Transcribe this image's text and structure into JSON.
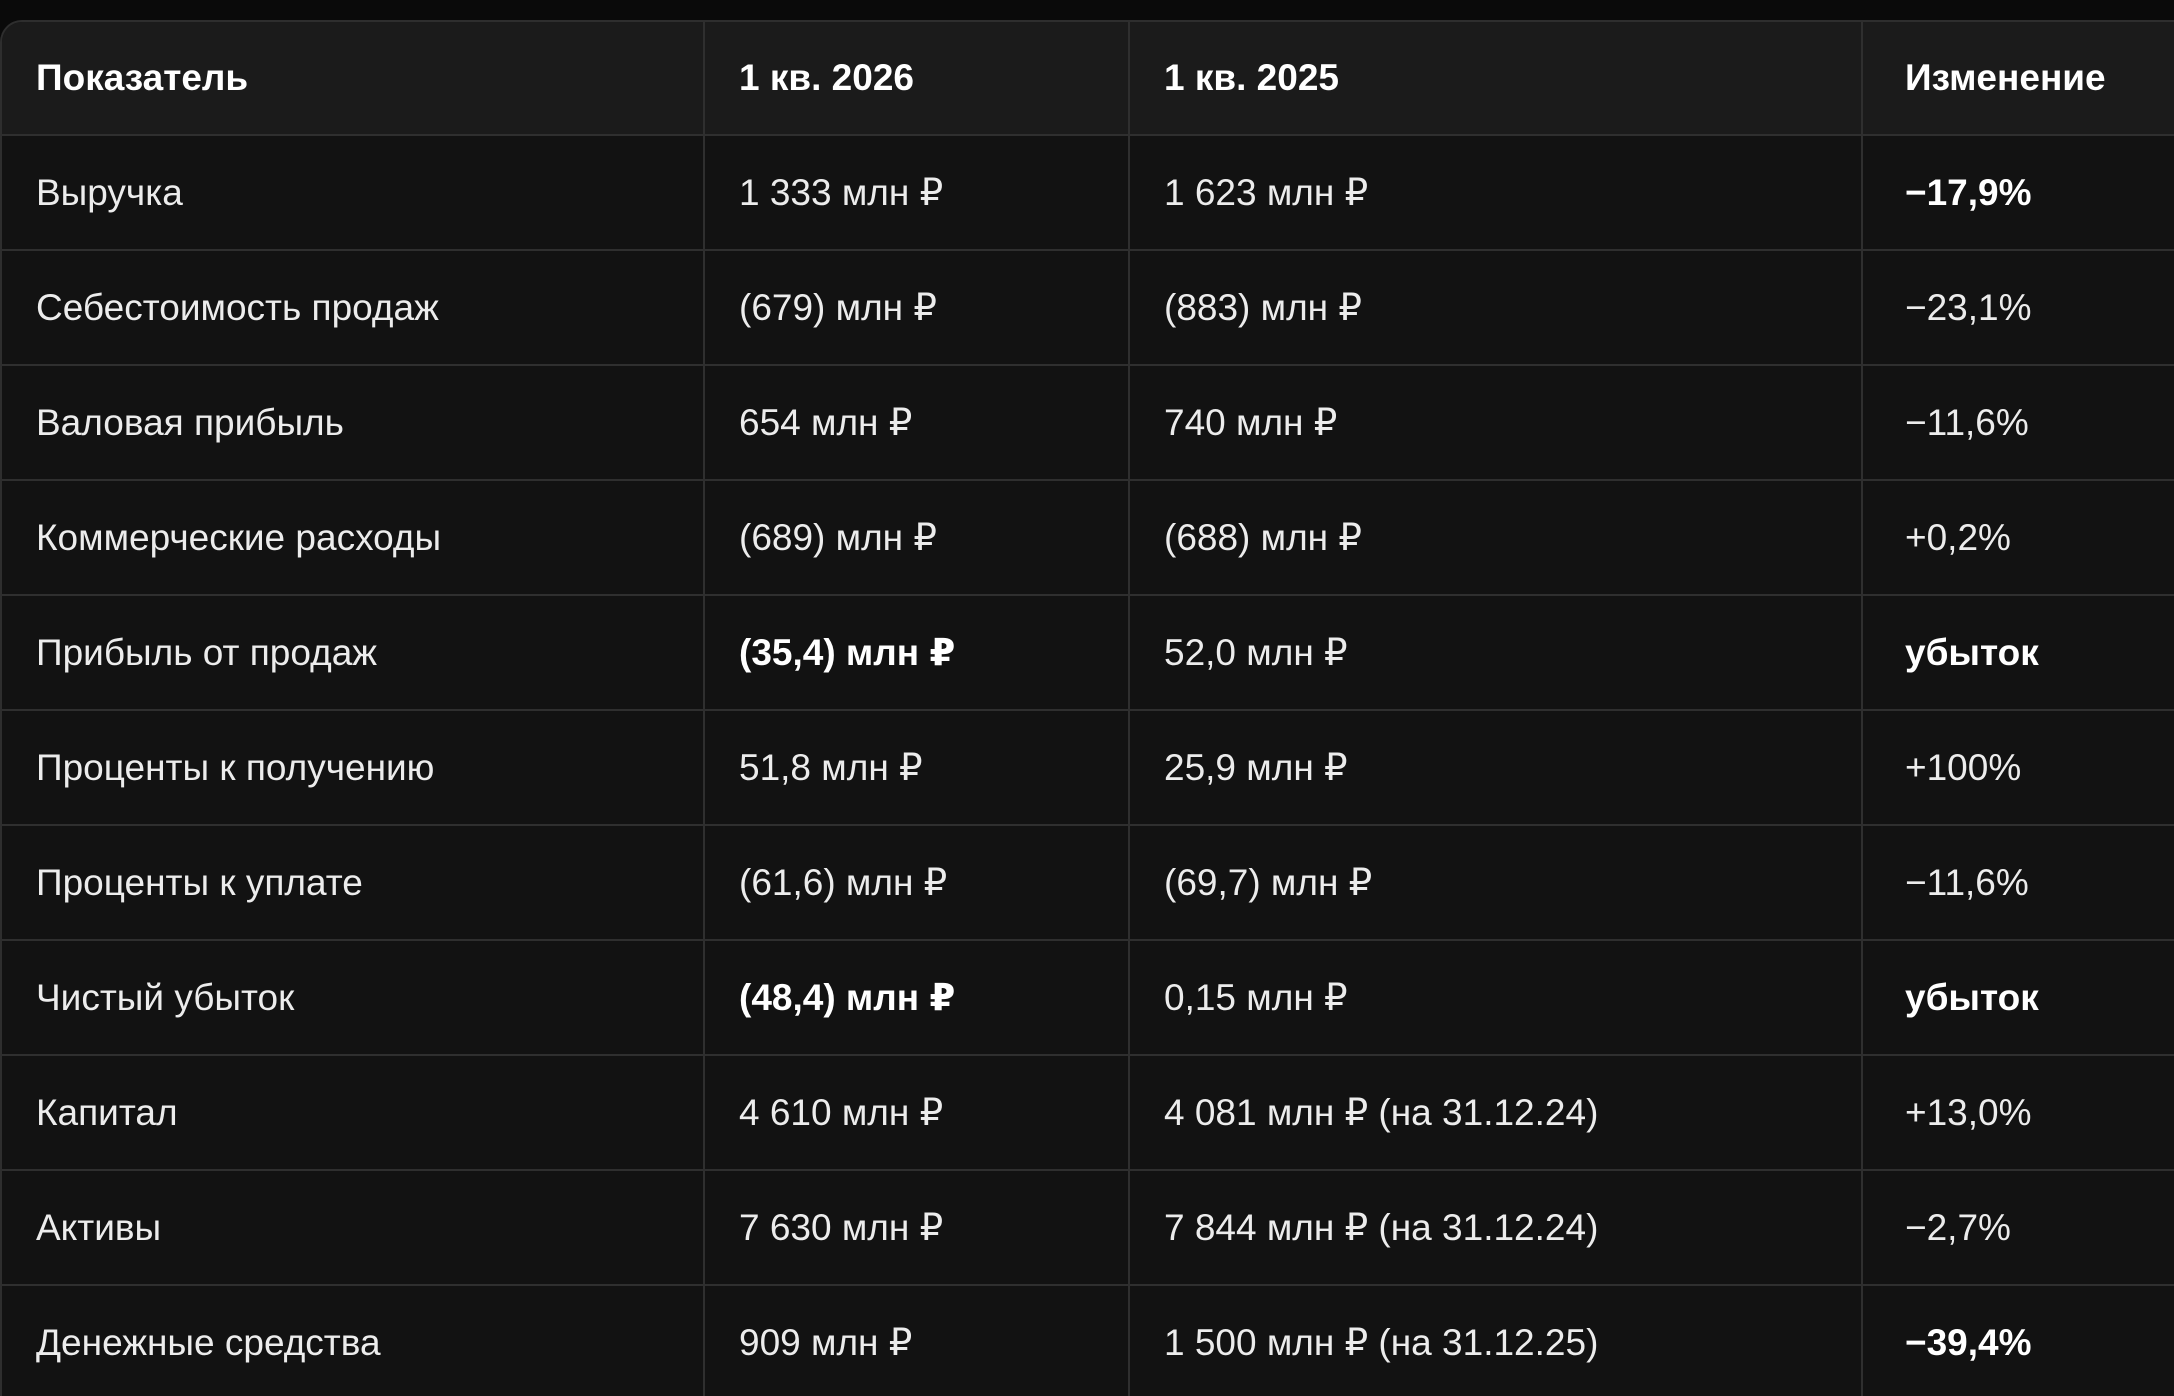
{
  "table": {
    "headers": [
      "Показатель",
      "1 кв. 2026",
      "1 кв. 2025",
      "Изменение"
    ],
    "rows": [
      [
        "Выручка",
        "1 333 млн ₽",
        "1 623 млн ₽",
        "−17,9%"
      ],
      [
        "Себестоимость продаж",
        "(679) млн ₽",
        "(883) млн ₽",
        "−23,1%"
      ],
      [
        "Валовая прибыль",
        "654 млн ₽",
        "740 млн ₽",
        "−11,6%"
      ],
      [
        "Коммерческие расходы",
        "(689) млн ₽",
        "(688) млн ₽",
        "+0,2%"
      ],
      [
        "Прибыль от продаж",
        "(35,4) млн ₽",
        "52,0 млн ₽",
        "убыток"
      ],
      [
        "Проценты к получению",
        "51,8 млн ₽",
        "25,9 млн ₽",
        "+100%"
      ],
      [
        "Проценты к уплате",
        "(61,6) млн ₽",
        "(69,7) млн ₽",
        "−11,6%"
      ],
      [
        "Чистый убыток",
        "(48,4) млн ₽",
        "0,15 млн ₽",
        "убыток"
      ],
      [
        "Капитал",
        "4 610 млн ₽",
        "4 081 млн ₽ (на 31.12.24)",
        "+13,0%"
      ],
      [
        "Активы",
        "7 630 млн ₽",
        "7 844 млн ₽ (на 31.12.24)",
        "−2,7%"
      ],
      [
        "Денежные средства",
        "909 млн ₽",
        "1 500 млн ₽ (на 31.12.25)",
        "−39,4%"
      ]
    ]
  }
}
